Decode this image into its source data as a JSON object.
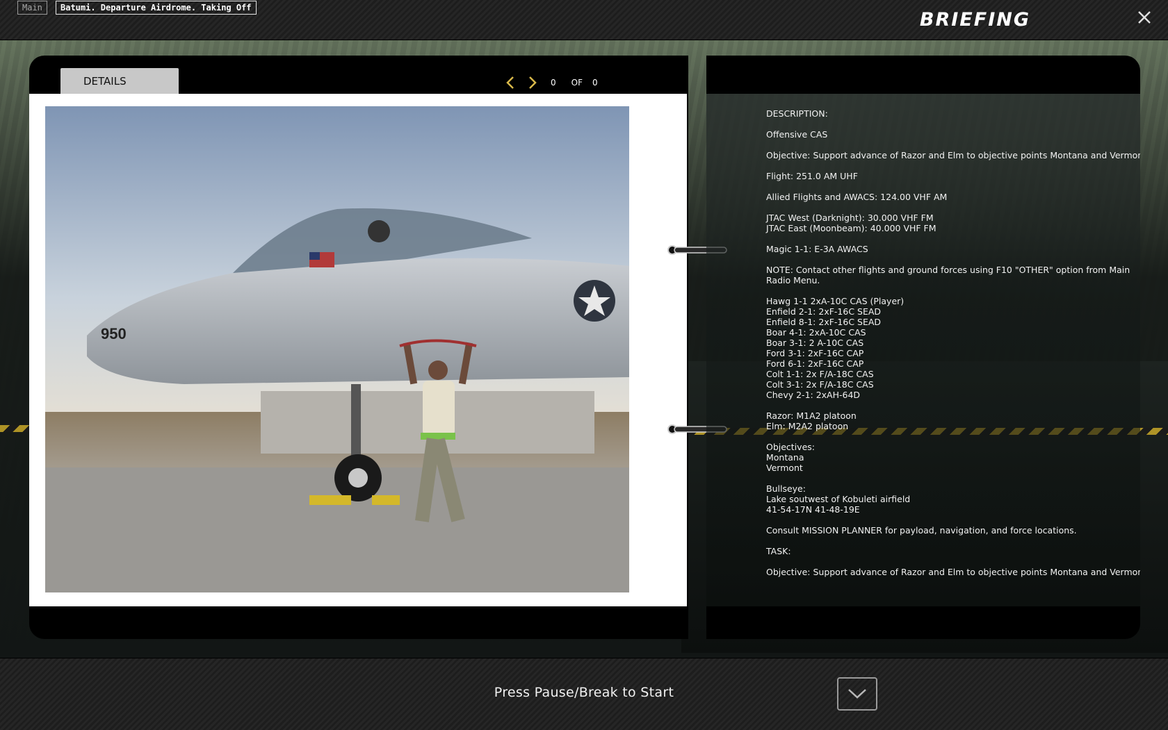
{
  "topbar": {
    "main_tag": "Main",
    "mission_name": "Batumi. Departure Airdrome. Taking Off",
    "title": "BRIEFING",
    "close_icon": "close-icon"
  },
  "details": {
    "tab_label": "DETAILS",
    "pager": {
      "current": "0",
      "of_label": "OF",
      "total": "0"
    },
    "image_icon": "a10-aircraft-photo"
  },
  "briefing": {
    "lines": [
      "DESCRIPTION:",
      "",
      "Offensive CAS",
      "",
      "Objective: Support advance of Razor and Elm to objective points Montana and Vermont.",
      "",
      "Flight: 251.0 AM UHF",
      "",
      "Allied Flights and AWACS: 124.00 VHF AM",
      "",
      "JTAC West (Darknight): 30.000 VHF FM",
      "JTAC East (Moonbeam): 40.000 VHF FM",
      "",
      "Magic 1-1: E-3A AWACS",
      "",
      "NOTE: Contact other flights and ground forces using F10 \"OTHER\" option from Main",
      "Radio Menu.",
      "",
      "Hawg 1-1 2xA-10C CAS (Player)",
      "Enfield 2-1: 2xF-16C SEAD",
      "Enfield 8-1: 2xF-16C SEAD",
      "Boar 4-1: 2xA-10C CAS",
      "Boar  3-1: 2 A-10C CAS",
      "Ford 3-1: 2xF-16C CAP",
      "Ford 6-1: 2xF-16C CAP",
      "Colt 1-1: 2x F/A-18C CAS",
      "Colt 3-1: 2x F/A-18C CAS",
      "Chevy 2-1: 2xAH-64D",
      "",
      "Razor: M1A2 platoon",
      "Elm: M2A2 platoon",
      "",
      "Objectives:",
      "Montana",
      "Vermont",
      "",
      "Bullseye:",
      "Lake soutwest of Kobuleti airfield",
      "41-54-17N 41-48-19E",
      "",
      "Consult MISSION PLANNER for payload, navigation, and force locations.",
      "",
      "TASK:",
      "",
      "Objective: Support advance of Razor and Elm to objective points Montana and Vermont."
    ]
  },
  "bottombar": {
    "start_text": "Press Pause/Break to Start",
    "start_icon": "checkmark-icon"
  },
  "colors": {
    "accent_arrow": "#d8b84a",
    "tab_bg": "#c8c8c8"
  }
}
